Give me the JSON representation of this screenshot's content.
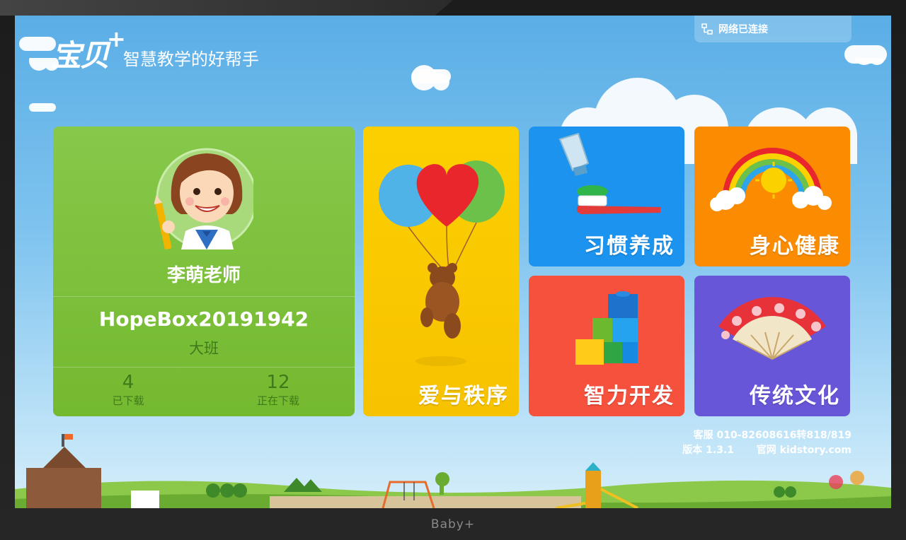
{
  "device_brand": "Baby+",
  "network_status": "网络已连接",
  "logo": {
    "mark": "宝贝",
    "plus": "+",
    "slogan": "智慧教学的好帮手"
  },
  "profile": {
    "teacher_name": "李萌老师",
    "device_id": "HopeBox20191942",
    "class_name": "大班",
    "downloaded_count": "4",
    "downloaded_label": "已下载",
    "downloading_count": "12",
    "downloading_label": "正在下载"
  },
  "tiles": {
    "love_order": "爱与秩序",
    "habit": "习惯养成",
    "health": "身心健康",
    "intelligence": "智力开发",
    "culture": "传统文化"
  },
  "footer": {
    "service": "客服 010-82608616转818/819",
    "version": "版本 1.3.1",
    "website": "官网 kidstory.com"
  },
  "colors": {
    "profile": "#7cbd3a",
    "love_order": "#f9c900",
    "habit": "#1b93ef",
    "health": "#fb8b00",
    "intelligence": "#f5513d",
    "culture": "#6757d8"
  }
}
